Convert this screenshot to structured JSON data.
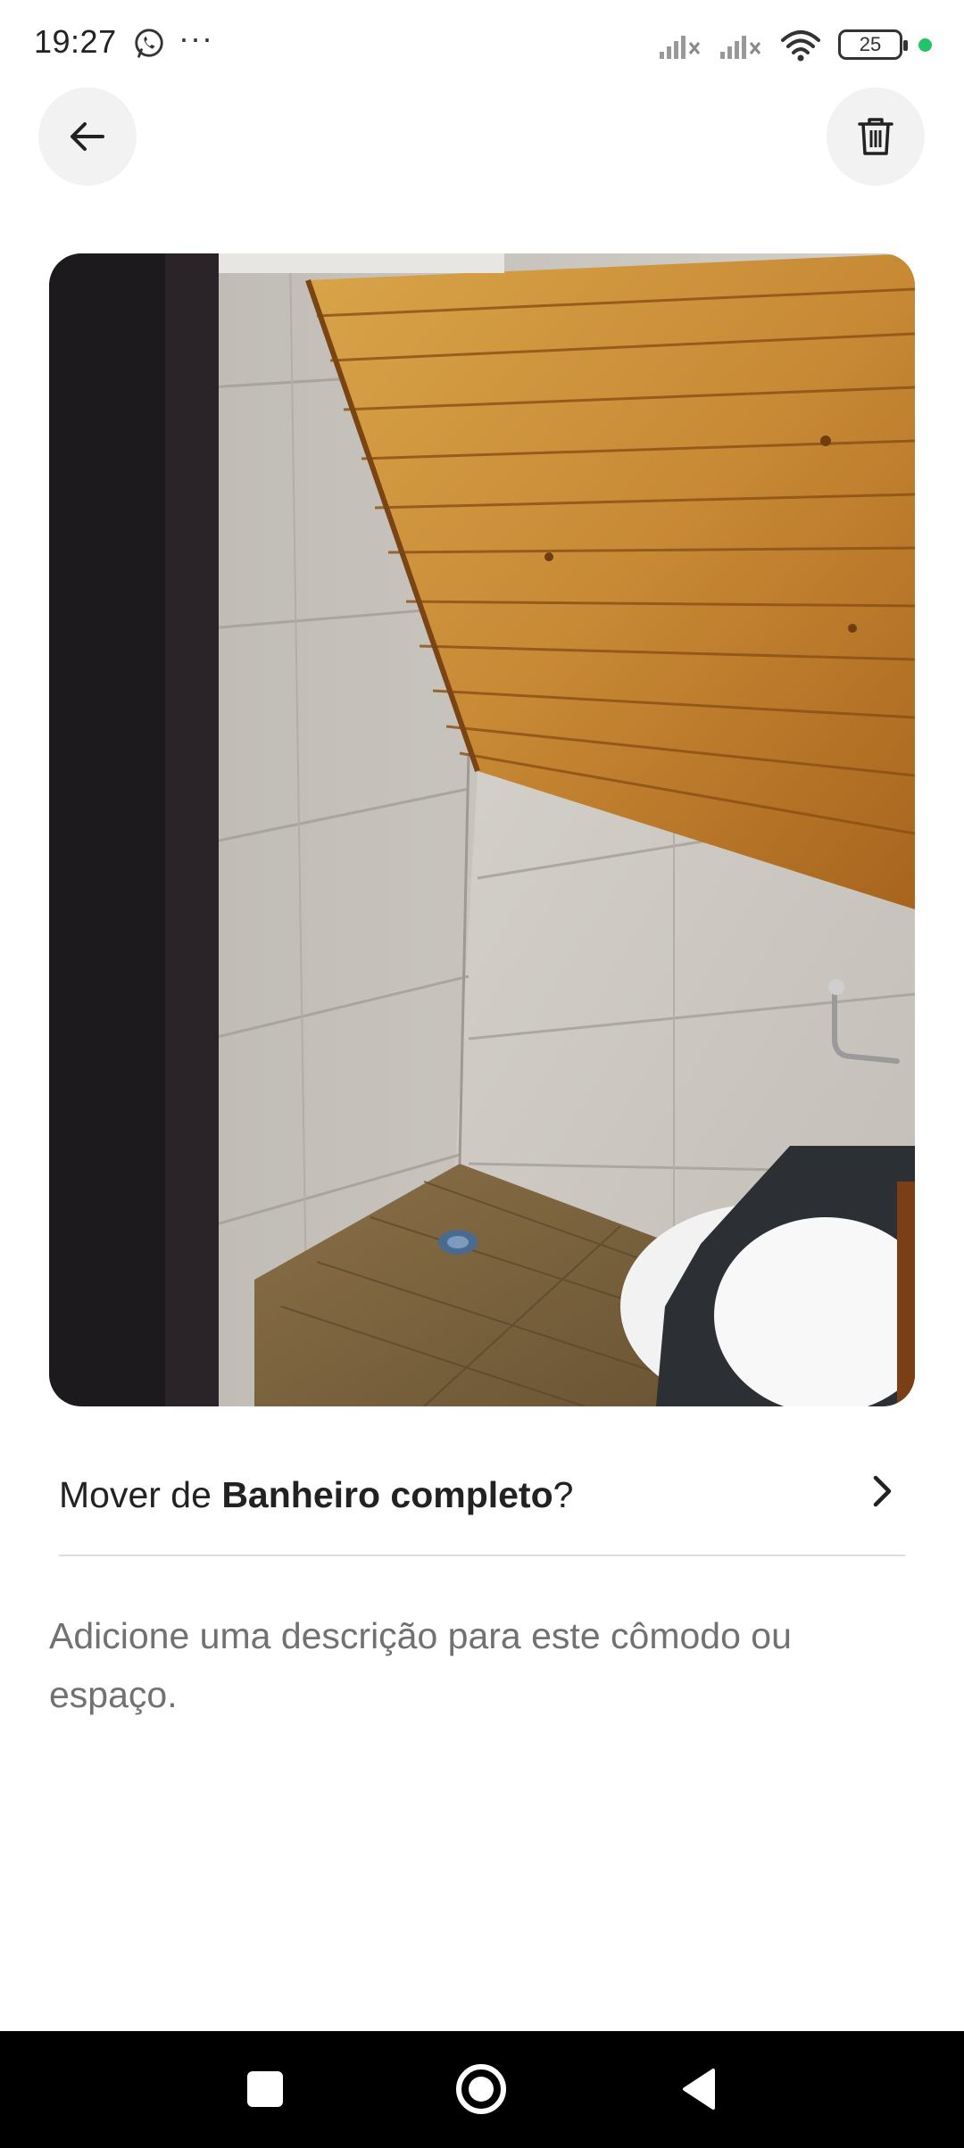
{
  "status_bar": {
    "time": "19:27",
    "dots": "···",
    "battery_level": "25",
    "icons": [
      "whatsapp-icon",
      "signal-icon",
      "signal-icon",
      "wifi-icon",
      "battery-icon"
    ],
    "indicator_color": "#25c26a"
  },
  "header": {
    "back_icon": "arrow-left-icon",
    "delete_icon": "trash-icon"
  },
  "photo": {
    "subject": "bathroom-photo"
  },
  "move_row": {
    "prefix": "Mover de ",
    "room": "Banheiro completo",
    "suffix": "?"
  },
  "description": {
    "placeholder": "Adicione uma descrição para este cômodo ou espaço."
  },
  "nav_bar": {
    "icons": [
      "recents-square-icon",
      "home-circle-icon",
      "back-triangle-icon"
    ]
  }
}
